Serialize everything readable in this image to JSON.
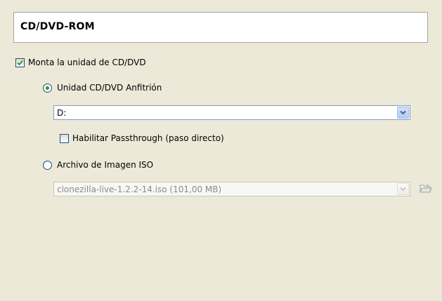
{
  "section": {
    "title": "CD/DVD-ROM"
  },
  "mount_checkbox": {
    "label": "Monta la unidad de CD/DVD",
    "checked": true
  },
  "host_drive": {
    "label": "Unidad CD/DVD Anfitrión",
    "selected": true,
    "drive_value": "D:",
    "passthrough_label": "Habilitar Passthrough (paso directo)",
    "passthrough_checked": false
  },
  "iso_file": {
    "label": "Archivo de Imagen ISO",
    "selected": false,
    "file_value": "clonezilla-live-1.2.2-14.iso (101,00 MB)"
  },
  "icons": [
    "checkmark-icon",
    "chevron-down-icon",
    "open-folder-icon"
  ],
  "colors": {
    "background": "#ece9d8",
    "check": "#21a121",
    "field_border": "#7f9db9"
  }
}
